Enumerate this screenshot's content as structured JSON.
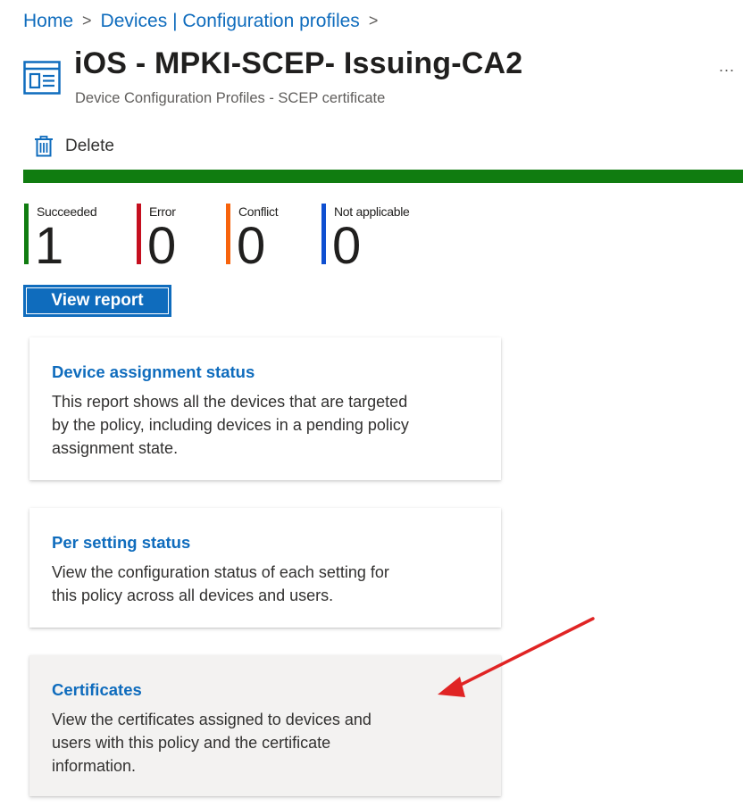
{
  "breadcrumb": {
    "items": [
      {
        "label": "Home"
      },
      {
        "label": "Devices | Configuration profiles"
      }
    ],
    "separator": ">"
  },
  "header": {
    "title": "iOS - MPKI-SCEP- Issuing-CA2",
    "subtitle": "Device Configuration Profiles - SCEP certificate",
    "more_label": "...",
    "icon": "configuration-profile-icon"
  },
  "toolbar": {
    "delete_label": "Delete",
    "delete_icon": "trash-icon"
  },
  "progress": {
    "succeeded_fraction": 1.0,
    "color": "#107c10"
  },
  "status": {
    "items": [
      {
        "label": "Succeeded",
        "count": "1",
        "color": "#107c10"
      },
      {
        "label": "Error",
        "count": "0",
        "color": "#c50f1f"
      },
      {
        "label": "Conflict",
        "count": "0",
        "color": "#f7630c"
      },
      {
        "label": "Not applicable",
        "count": "0",
        "color": "#0f4fd1"
      }
    ]
  },
  "view_report_label": "View report",
  "cards": [
    {
      "title": "Device assignment status",
      "desc": "This report shows all the devices that are targeted by the policy, including devices in a pending policy assignment state."
    },
    {
      "title": "Per setting status",
      "desc": "View the configuration status of each setting for this policy across all devices and users."
    },
    {
      "title": "Certificates",
      "desc": "View the certificates assigned to devices and users with this policy and the certificate information."
    }
  ],
  "colors": {
    "link": "#0f6cbd",
    "annotation_arrow": "#e02424"
  }
}
